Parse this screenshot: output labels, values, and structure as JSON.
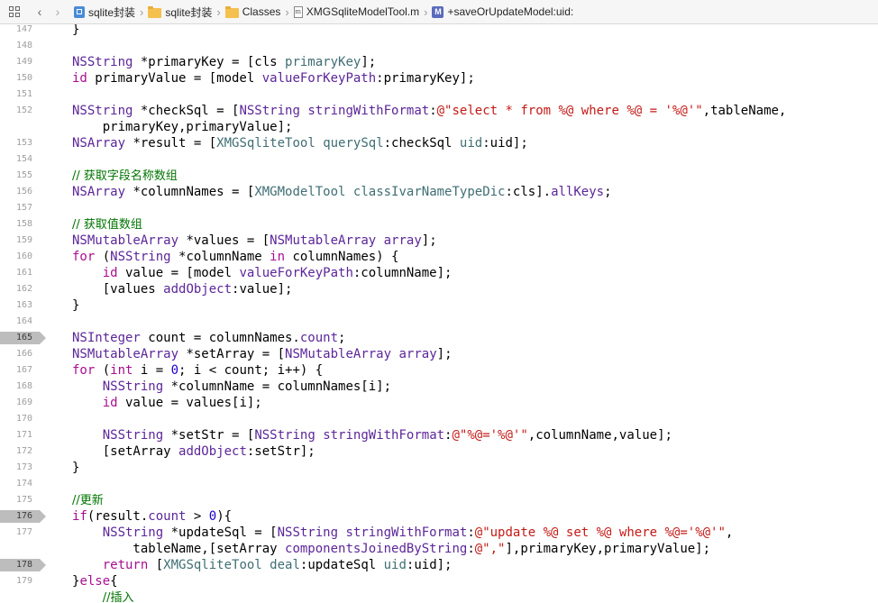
{
  "jumpbar": {
    "crumbs": [
      {
        "label": "sqlite封装",
        "icon": "project-icon"
      },
      {
        "label": "sqlite封装",
        "icon": "folder-icon"
      },
      {
        "label": "Classes",
        "icon": "folder-icon"
      },
      {
        "label": "XMGSqliteModelTool.m",
        "icon": "m-file-icon"
      },
      {
        "label": "+saveOrUpdateModel:uid:",
        "icon": "method-icon"
      }
    ],
    "file_icon_letter": "m",
    "method_icon_letter": "M"
  },
  "editor": {
    "lines": [
      {
        "num": "147",
        "marked": false
      },
      {
        "num": "148",
        "marked": false
      },
      {
        "num": "149",
        "marked": false
      },
      {
        "num": "150",
        "marked": false
      },
      {
        "num": "151",
        "marked": false
      },
      {
        "num": "152",
        "marked": false
      },
      {
        "num": "",
        "marked": false
      },
      {
        "num": "153",
        "marked": false
      },
      {
        "num": "154",
        "marked": false
      },
      {
        "num": "155",
        "marked": false
      },
      {
        "num": "156",
        "marked": false
      },
      {
        "num": "157",
        "marked": false
      },
      {
        "num": "158",
        "marked": false
      },
      {
        "num": "159",
        "marked": false
      },
      {
        "num": "160",
        "marked": false
      },
      {
        "num": "161",
        "marked": false
      },
      {
        "num": "162",
        "marked": false
      },
      {
        "num": "163",
        "marked": false
      },
      {
        "num": "164",
        "marked": false
      },
      {
        "num": "165",
        "marked": true
      },
      {
        "num": "166",
        "marked": false
      },
      {
        "num": "167",
        "marked": false
      },
      {
        "num": "168",
        "marked": false
      },
      {
        "num": "169",
        "marked": false
      },
      {
        "num": "170",
        "marked": false
      },
      {
        "num": "171",
        "marked": false
      },
      {
        "num": "172",
        "marked": false
      },
      {
        "num": "173",
        "marked": false
      },
      {
        "num": "174",
        "marked": false
      },
      {
        "num": "175",
        "marked": false
      },
      {
        "num": "176",
        "marked": true
      },
      {
        "num": "177",
        "marked": false
      },
      {
        "num": "",
        "marked": false
      },
      {
        "num": "178",
        "marked": true
      },
      {
        "num": "179",
        "marked": false
      },
      {
        "num": "",
        "marked": false
      }
    ],
    "code": {
      "l147": [
        "}"
      ],
      "l149": [
        "NSString",
        " *primaryKey = [cls ",
        "primaryKey",
        "];"
      ],
      "l150": [
        "id",
        " primaryValue = [model ",
        "valueForKeyPath",
        ":primaryKey];"
      ],
      "l152": [
        "NSString",
        " *checkSql = [",
        "NSString",
        " ",
        "stringWithFormat",
        ":",
        "@\"select * from %@ where %@ = '%@'\"",
        ",tableName,"
      ],
      "l152b": [
        "    primaryKey,primaryValue];"
      ],
      "l153": [
        "NSArray",
        " *result = [",
        "XMGSqliteTool",
        " ",
        "querySql",
        ":checkSql ",
        "uid",
        ":uid];"
      ],
      "l155": [
        "// 获取字段名称数组"
      ],
      "l156": [
        "NSArray",
        " *columnNames = [",
        "XMGModelTool",
        " ",
        "classIvarNameTypeDic",
        ":cls].",
        "allKeys",
        ";"
      ],
      "l158": [
        "// 获取值数组"
      ],
      "l159": [
        "NSMutableArray",
        " *values = [",
        "NSMutableArray",
        " ",
        "array",
        "];"
      ],
      "l160": [
        "for",
        " (",
        "NSString",
        " *columnName ",
        "in",
        " columnNames) {"
      ],
      "l161": [
        "    ",
        "id",
        " value = [model ",
        "valueForKeyPath",
        ":columnName];"
      ],
      "l162": [
        "    [values ",
        "addObject",
        ":value];"
      ],
      "l163": [
        "}"
      ],
      "l165": [
        "NSInteger",
        " count = columnNames.",
        "count",
        ";"
      ],
      "l166": [
        "NSMutableArray",
        " *setArray = [",
        "NSMutableArray",
        " ",
        "array",
        "];"
      ],
      "l167": [
        "for",
        " (",
        "int",
        " i = ",
        "0",
        "; i < count; i++) {"
      ],
      "l168": [
        "    ",
        "NSString",
        " *columnName = columnNames[i];"
      ],
      "l169": [
        "    ",
        "id",
        " value = values[i];"
      ],
      "l171": [
        "    ",
        "NSString",
        " *setStr = [",
        "NSString",
        " ",
        "stringWithFormat",
        ":",
        "@\"%@='%@'\"",
        ",columnName,value];"
      ],
      "l172": [
        "    [setArray ",
        "addObject",
        ":setStr];"
      ],
      "l173": [
        "}"
      ],
      "l175": [
        "//更新"
      ],
      "l176": [
        "if",
        "(result.",
        "count",
        " > ",
        "0",
        "){"
      ],
      "l177": [
        "    ",
        "NSString",
        " *updateSql = [",
        "NSString",
        " ",
        "stringWithFormat",
        ":",
        "@\"update %@ set %@ where %@='%@'\"",
        ","
      ],
      "l177b": [
        "        tableName,[setArray ",
        "componentsJoinedByString",
        ":",
        "@\",\"",
        "],primaryKey,primaryValue];"
      ],
      "l178": [
        "    ",
        "return",
        " [",
        "XMGSqliteTool",
        " ",
        "deal",
        ":updateSql ",
        "uid",
        ":uid];"
      ],
      "l179": [
        "}",
        "else",
        "{"
      ],
      "l180": [
        "    ",
        "//插入"
      ]
    }
  },
  "colors": {
    "keyword": "#aa0d91",
    "class": "#5c2699",
    "comment": "#007400",
    "string": "#c41a16",
    "number": "#1c00cf",
    "project_method": "#3f6e74",
    "marker": "#bdbdbd"
  }
}
